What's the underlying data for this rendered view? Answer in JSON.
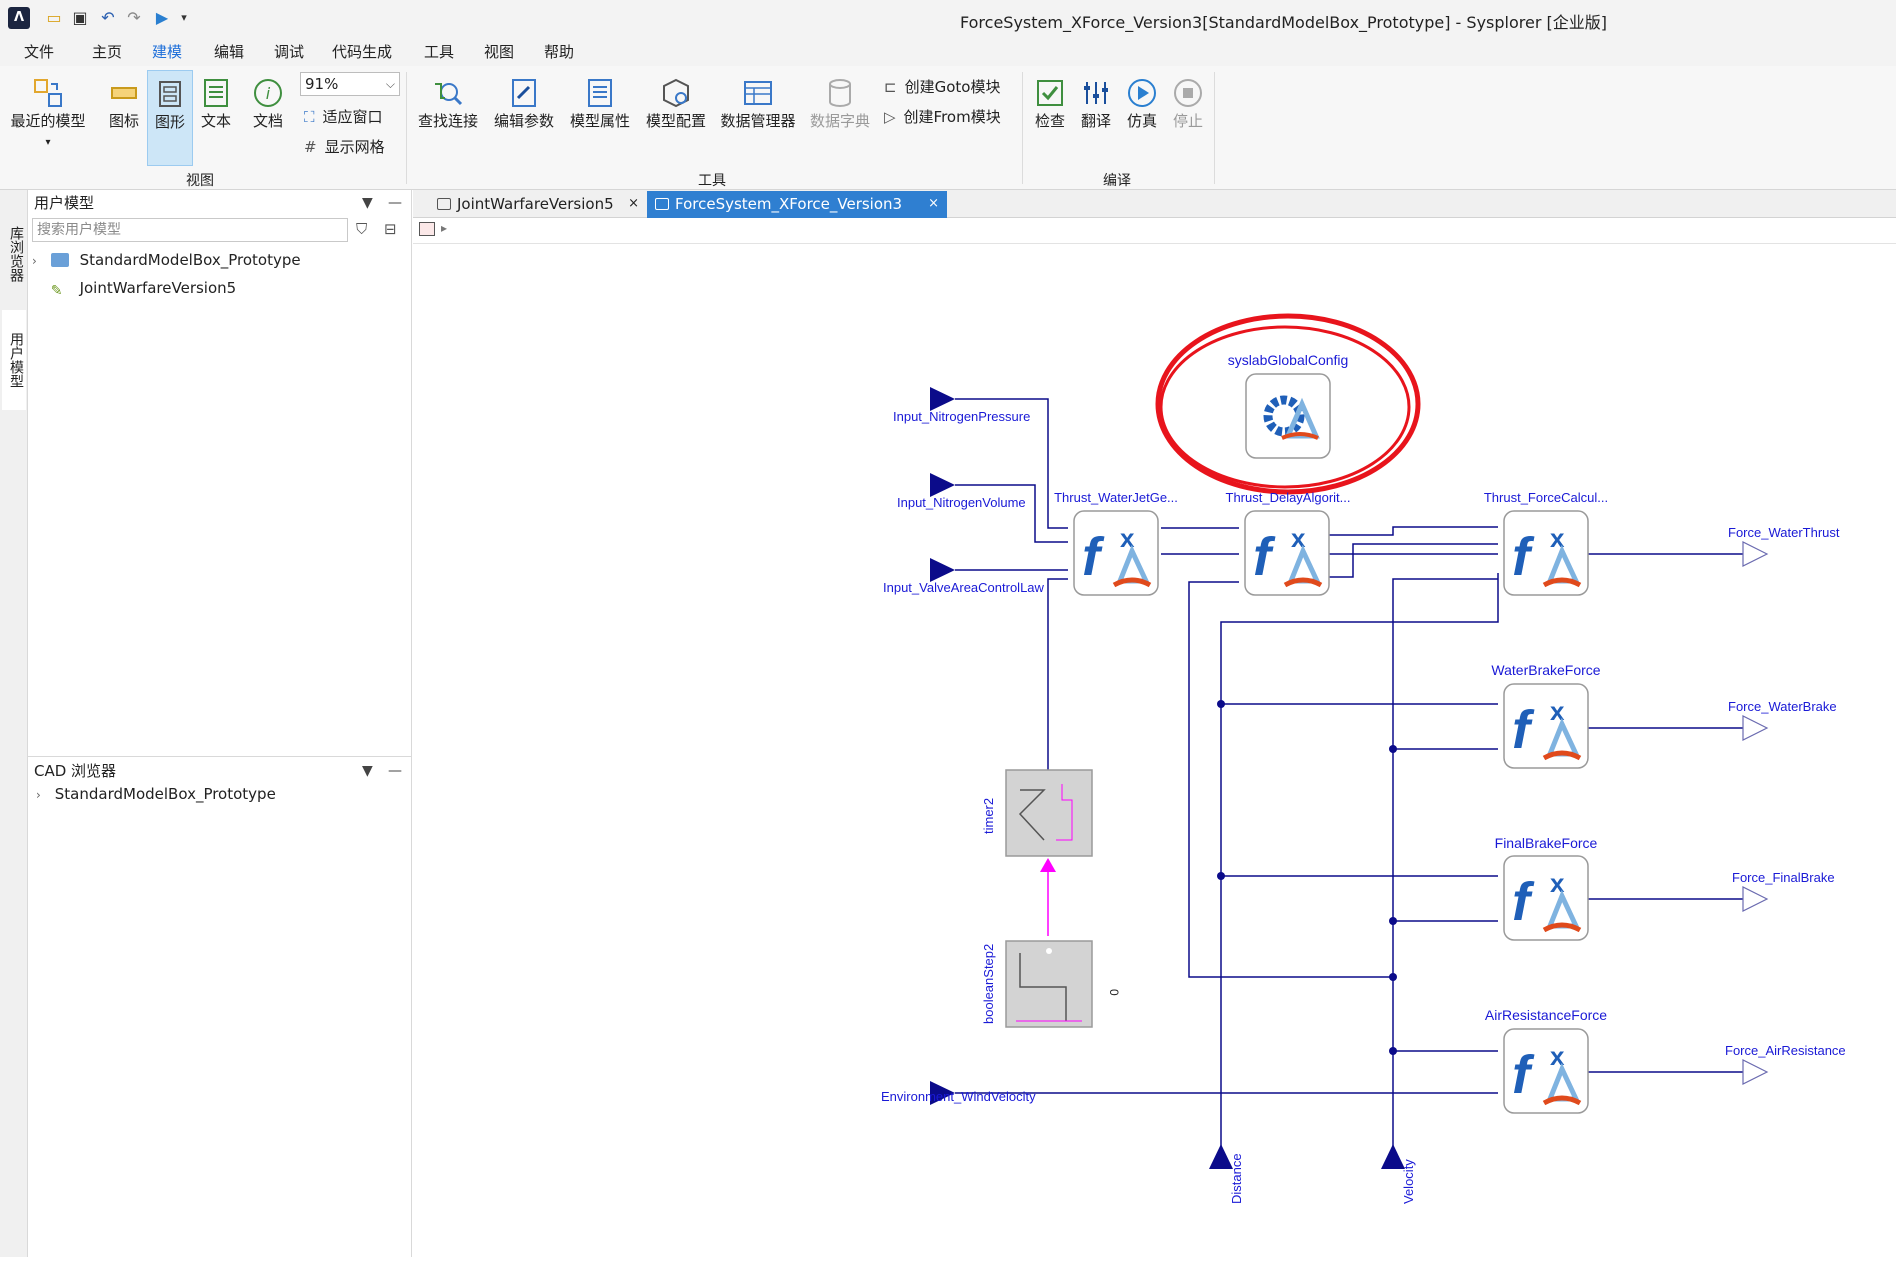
{
  "window": {
    "title": "ForceSystem_XForce_Version3[StandardModelBox_Prototype] - Sysplorer [企业版]",
    "app_icon": "sysplorer-logo"
  },
  "menu_tabs": [
    "文件",
    "主页",
    "建模",
    "编辑",
    "调试",
    "代码生成",
    "工具",
    "视图",
    "帮助"
  ],
  "active_menu_tab": "建模",
  "ribbon": {
    "view_group": {
      "label": "视图",
      "recent_models": "最近的模型",
      "icon_view": "图标",
      "diagram_view": "图形",
      "text_view": "文本",
      "doc_view": "文档",
      "zoom": "91%",
      "fit_window": "适应窗口",
      "show_grid": "显示网格"
    },
    "tools_group": {
      "label": "工具",
      "find_connection": "查找连接",
      "edit_params": "编辑参数",
      "model_props": "模型属性",
      "model_config": "模型配置",
      "data_manager": "数据管理器",
      "data_dictionary": "数据字典",
      "create_goto": "创建Goto模块",
      "create_from": "创建From模块"
    },
    "compile_group": {
      "label": "编译",
      "check": "检查",
      "translate": "翻译",
      "simulate": "仿真",
      "stop": "停止"
    }
  },
  "side_tabs": [
    "库浏览器",
    "用户模型"
  ],
  "user_models_panel": {
    "title": "用户模型",
    "search_placeholder": "搜索用户模型",
    "items": [
      "StandardModelBox_Prototype",
      "JointWarfareVersion5"
    ]
  },
  "cad_panel": {
    "title": "CAD 浏览器",
    "items": [
      "StandardModelBox_Prototype"
    ]
  },
  "doc_tabs": [
    "JointWarfareVersion5",
    "ForceSystem_XForce_Version3"
  ],
  "diagram": {
    "config_block": "syslabGlobalConfig",
    "inputs": {
      "nitrogen_pressure": "Input_NitrogenPressure",
      "nitrogen_volume": "Input_NitrogenVolume",
      "valve_area": "Input_ValveAreaControlLaw",
      "wind_velocity": "Environment_WindVelocity"
    },
    "blocks": {
      "waterjet": "Thrust_WaterJetGe...",
      "delay": "Thrust_DelayAlgorit...",
      "forcecalc": "Thrust_ForceCalcul...",
      "waterbrake": "WaterBrakeForce",
      "finalbrake": "FinalBrakeForce",
      "airresistance": "AirResistanceForce",
      "timer": "timer2",
      "booleanstep": "booleanStep2",
      "booleanstep_value": "0"
    },
    "outputs": {
      "water_thrust": "Force_WaterThrust",
      "water_brake": "Force_WaterBrake",
      "final_brake": "Force_FinalBrake",
      "air_resistance": "Force_AirResistance"
    },
    "bottom_inputs": {
      "distance": "Distance",
      "velocity": "Velocity"
    },
    "colors": {
      "wire": "#0b0b8a",
      "label": "#1a1ad6",
      "boolean_wire": "#ff00ff",
      "highlight": "#e8141c",
      "fx_blue": "#1f5fb8"
    }
  }
}
